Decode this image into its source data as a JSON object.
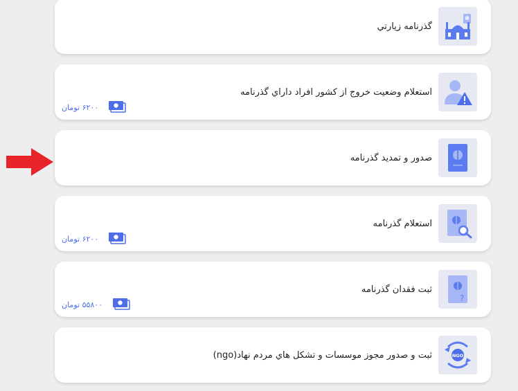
{
  "services": [
    {
      "title": "گذرنامه زيارتي",
      "price": null,
      "icon": "mosque-passport-icon"
    },
    {
      "title": "استعلام وضعيت خروج از کشور افراد داراي گذرنامه",
      "price": "۶۲۰۰ تومان",
      "icon": "user-warning-icon"
    },
    {
      "title": "صدور و تمديد گذرنامه",
      "price": null,
      "icon": "passport-icon"
    },
    {
      "title": "استعلام گذرنامه",
      "price": "۶۲۰۰ تومان",
      "icon": "passport-search-icon"
    },
    {
      "title": "ثبت فقدان گذرنامه",
      "price": "۵۵۸۰۰ تومان",
      "icon": "passport-question-icon"
    },
    {
      "title": "ثبت و صدور مجوز موسسات و تشکل هاي مردم نهاد(ngo)",
      "price": null,
      "icon": "ngo-icon"
    }
  ],
  "colors": {
    "accent": "#4d6ee8",
    "icon_blue": "#5b7bf0",
    "icon_light": "#a7b7f5",
    "pointer_arrow": "#e8242a",
    "card_bg": "#ffffff",
    "page_bg": "#eeeeee"
  },
  "pointer": {
    "icon": "red-arrow-icon",
    "points_to": "صدور و تمديد گذرنامه"
  }
}
